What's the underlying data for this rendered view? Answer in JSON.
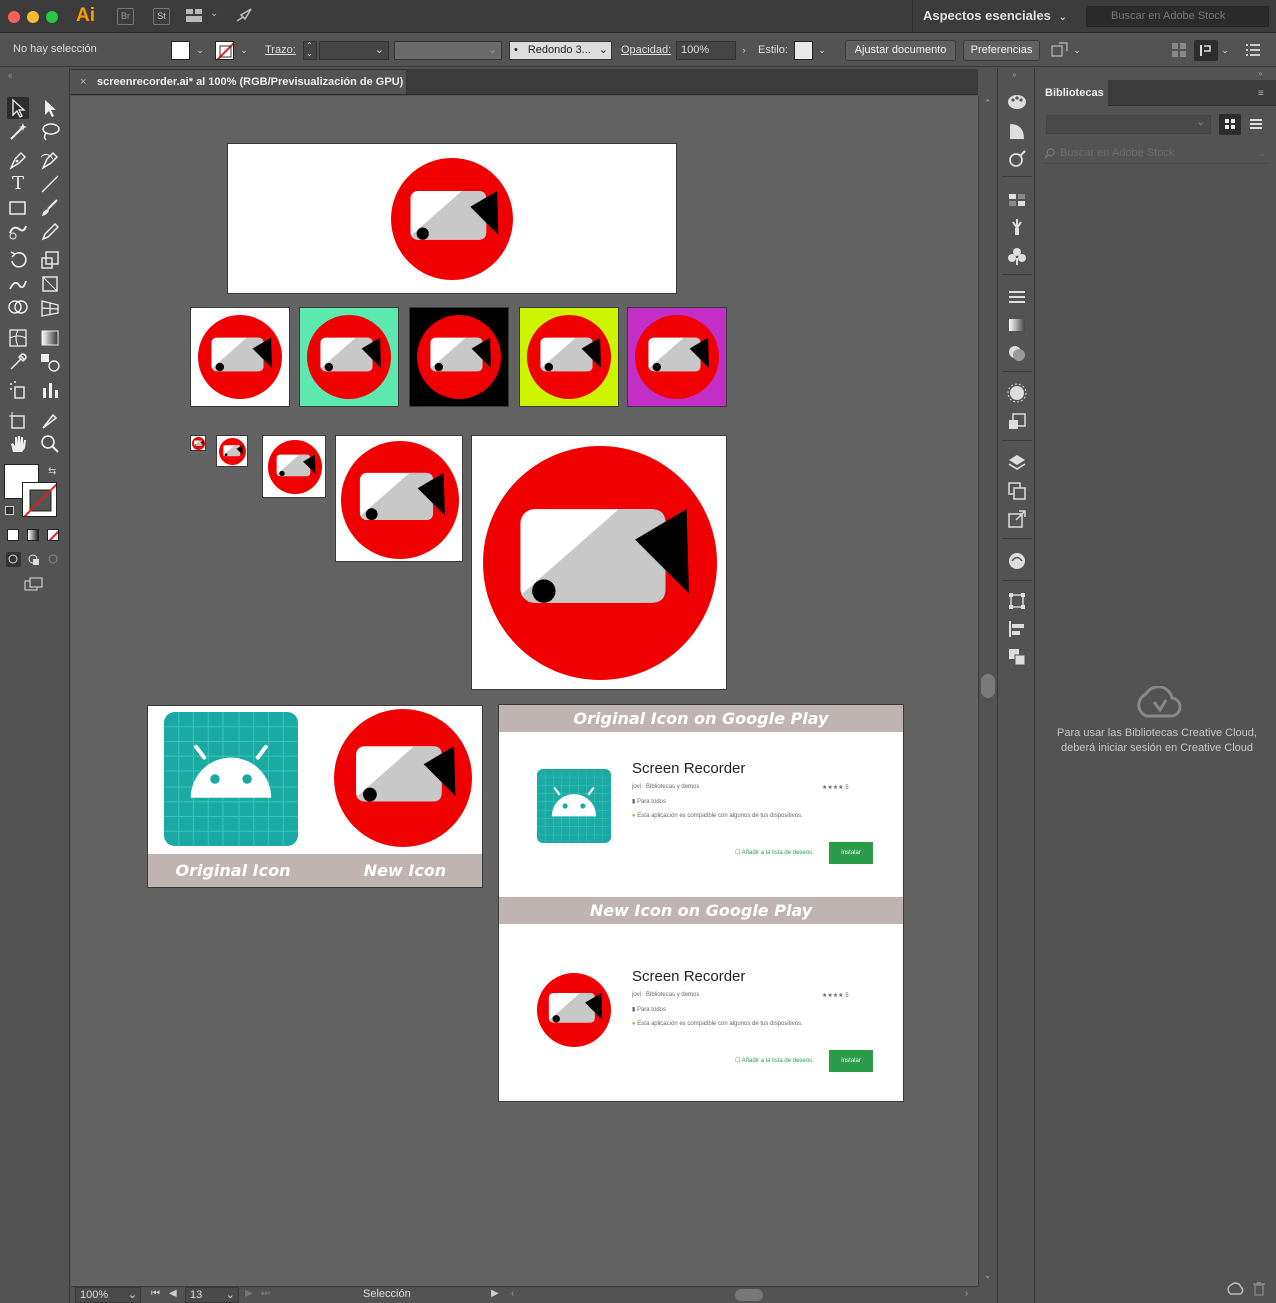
{
  "app": {
    "logo": "Ai",
    "bridge_chip": "Br",
    "stock_chip": "St",
    "workspace": "Aspectos esenciales",
    "stock_search_placeholder": "Buscar en Adobe Stock"
  },
  "controlbar": {
    "selection": "No hay selección",
    "stroke_label": "Trazo:",
    "brush": "Redondo 3...",
    "opacity_label": "Opacidad:",
    "opacity_value": "100%",
    "style_label": "Estilo:",
    "fit_document": "Ajustar documento",
    "preferences": "Preferencias"
  },
  "document": {
    "tab_title": "screenrecorder.ai* al 100% (RGB/Previsualización de GPU)",
    "close_glyph": "×"
  },
  "artboards": {
    "background_colors": [
      "#ffffff",
      "#5de8b0",
      "#000000",
      "#cdf500",
      "#c12fc7"
    ],
    "comparison": {
      "original_label": "Original Icon",
      "new_label": "New Icon"
    },
    "google_play": {
      "original_header": "Original Icon on Google Play",
      "new_header": "New Icon on Google Play",
      "app_title": "Screen Recorder",
      "developer": "jovi",
      "category": "Bibliotecas y demos",
      "rating_count": "5",
      "audience": "Para todos",
      "compat_note": "Esta aplicación es compatible con algunos de tus dispositivos.",
      "wishlist": "Añadir a la lista de deseos",
      "install": "Instalar"
    }
  },
  "statusbar": {
    "zoom": "100%",
    "artboard_number": "13",
    "tool": "Selección"
  },
  "libraries": {
    "tab": "Bibliotecas",
    "search_placeholder": "Buscar en Adobe Stock",
    "message": "Para usar las Bibliotecas Creative Cloud, deberá iniciar sesión en Creative Cloud"
  },
  "colors": {
    "icon_red": "#f00000",
    "icon_gray": "#c8c8c8",
    "android_teal": "#1aa9a3",
    "header_taupe": "#bfb4b2",
    "install_green": "#2b9c4a"
  }
}
